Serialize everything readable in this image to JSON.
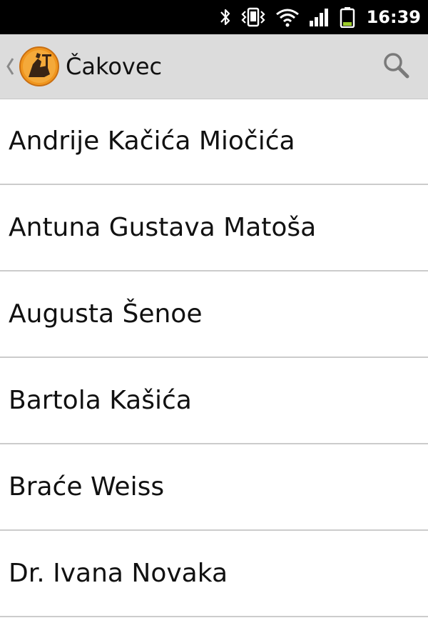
{
  "status_bar": {
    "time": "16:39",
    "icons": [
      "bluetooth-icon",
      "vibrate-icon",
      "wifi-icon",
      "signal-icon",
      "battery-icon"
    ]
  },
  "action_bar": {
    "title": "Čakovec",
    "app_icon": "city-crest-icon",
    "search_icon": "search-icon",
    "accent_color": "#f0961e"
  },
  "streets": [
    "Andrije Kačića Miočića",
    "Antuna Gustava Matoša",
    "Augusta Šenoe",
    "Bartola Kašića",
    "Braće Weiss",
    "Dr. Ivana Novaka"
  ]
}
